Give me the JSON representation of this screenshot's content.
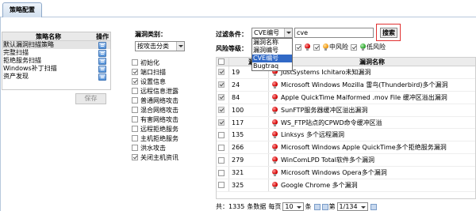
{
  "tab": {
    "label": "策略配置"
  },
  "policy": {
    "headers": {
      "name": "策略名称",
      "op": "操作"
    },
    "rows": [
      {
        "name": "默认漏洞扫描策略",
        "selected": true
      },
      {
        "name": "完整扫描",
        "selected": false
      },
      {
        "name": "拒绝服务扫描",
        "selected": false
      },
      {
        "name": "Windows补丁扫描",
        "selected": false
      },
      {
        "name": "资产发现",
        "selected": false
      }
    ],
    "save_label": "保存"
  },
  "category": {
    "label": "漏洞类别：",
    "value": "按攻击分类",
    "items": [
      {
        "label": "初始化",
        "checked": false
      },
      {
        "label": "端口扫描",
        "checked": true
      },
      {
        "label": "设置信息",
        "checked": true
      },
      {
        "label": "远程信息泄露",
        "checked": false
      },
      {
        "label": "普通网络攻击",
        "checked": false
      },
      {
        "label": "混合网络攻击",
        "checked": false
      },
      {
        "label": "有害网络攻击",
        "checked": false
      },
      {
        "label": "远程拒绝服务",
        "checked": false
      },
      {
        "label": "主机拒绝服务",
        "checked": false
      },
      {
        "label": "洪水攻击",
        "checked": false
      },
      {
        "label": "关闭主机资讯",
        "checked": true
      }
    ]
  },
  "filter": {
    "label": "过滤条件：",
    "field_value": "CVE编号",
    "options": [
      "漏洞名称",
      "漏洞编号",
      "CVE编号",
      "Bugtraq"
    ],
    "highlighted_index": 2,
    "search_value": "cve",
    "search_label": "搜索",
    "risk_label": "风险等级：",
    "risk_items": [
      {
        "label": "",
        "color": "red"
      },
      {
        "label": "中风险",
        "color": "orange"
      },
      {
        "label": "低风险",
        "color": "green"
      }
    ]
  },
  "table": {
    "headers": {
      "id": "漏洞编号",
      "name": "漏洞名称"
    },
    "rows": [
      {
        "id": "19",
        "name": "JustSystems Ichitaro未知漏洞",
        "checked": true
      },
      {
        "id": "24",
        "name": "Microsoft Windows Mozilla 雷鸟(Thunderbird)多个漏洞",
        "checked": true
      },
      {
        "id": "84",
        "name": "Apple QuickTime Malformed .mov File 缓冲区溢出漏洞",
        "checked": true
      },
      {
        "id": "100",
        "name": "SunFTP服务器缓冲区溢出漏洞",
        "checked": true
      },
      {
        "id": "117",
        "name": "WS_FTP站点的CPWD命令缓冲区溢",
        "checked": true
      },
      {
        "id": "135",
        "name": "Linksys 多个远程漏洞",
        "checked": false
      },
      {
        "id": "266",
        "name": "Microsoft Windows Apple QuickTime多个拒绝服务漏洞",
        "checked": false
      },
      {
        "id": "279",
        "name": "WinComLPD Total软件多个漏洞",
        "checked": false
      },
      {
        "id": "321",
        "name": "Microsoft Windows Opera多个漏洞",
        "checked": false
      },
      {
        "id": "325",
        "name": "Google Chrome 多个漏洞",
        "checked": false
      }
    ]
  },
  "pager": {
    "total_prefix": "共：",
    "total": "1335",
    "total_suffix": "条数据",
    "per_page_prefix": "每页",
    "per_page": "10",
    "per_page_suffix": "条",
    "page": "1/134"
  },
  "colors": {
    "accent": "#3169c6",
    "highlight_border": "#e03030"
  }
}
